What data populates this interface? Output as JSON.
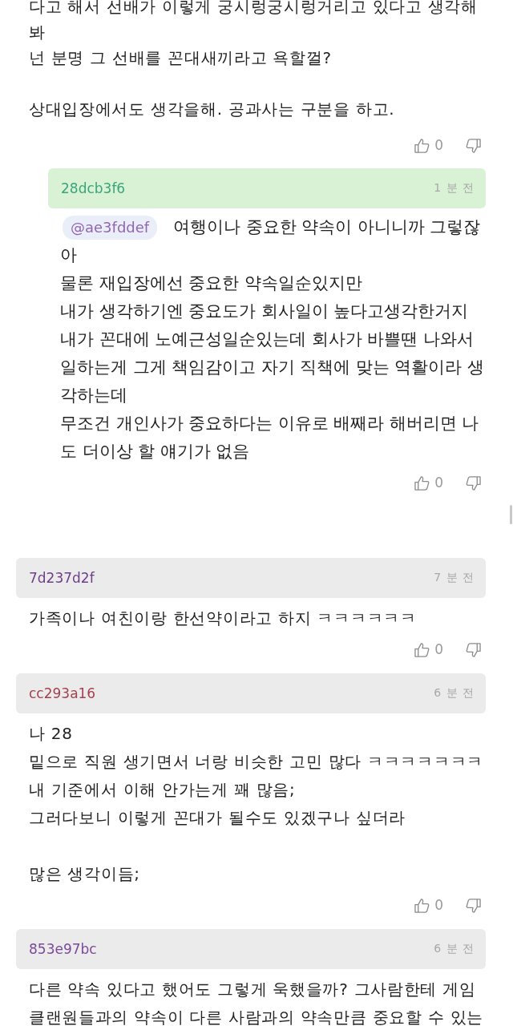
{
  "comments": [
    {
      "paragraphs": [
        [
          "다고 해서 선배가 이렇게 궁시렁궁시렁거리고 있다고 생각해봐",
          "넌 분명 그 선배를 꼰대새끼라고 욕할껄?"
        ],
        [
          "상대입장에서도 생각을해. 공과사는 구분을 하고."
        ]
      ],
      "votes": {
        "up": "0"
      },
      "replies": [
        {
          "author": "28dcb3f6",
          "color": "#3aa57a",
          "time": "1 분 전",
          "mention": "@ae3fddef",
          "paragraphs": [
            [
              "여행이나 중요한 약속이 아니니까 그렇잖아",
              "물론 재입장에선 중요한 약속일순있지만",
              "내가 생각하기엔 중요도가 회사일이 높다고생각한거지",
              "내가 꼰대에 노예근성일순있는데 회사가 바쁠땐 나와서 일하는게 그게 책임감이고 자기 직책에 맞는 역활이라 생각하는데",
              "무조건 개인사가 중요하다는 이유로 배째라 해버리면 나도 더이상 할 얘기가 없음"
            ]
          ],
          "votes": {
            "up": "0"
          }
        }
      ]
    },
    {
      "author": "7d237d2f",
      "color": "#6e3f88",
      "time": "7 분 전",
      "paragraphs": [
        [
          "가족이나 여친이랑 한선약이라고 하지 ㅋㅋㅋㅋㅋㅋ"
        ]
      ],
      "votes": {
        "up": "0"
      }
    },
    {
      "author": "cc293a16",
      "color": "#a5414f",
      "time": "6 분 전",
      "paragraphs": [
        [
          "나 28",
          "밑으로 직원 생기면서 너랑 비슷한 고민 많다 ㅋㅋㅋㅋㅋㅋㅋ",
          "내 기준에서 이해 안가는게 꽤 많음;",
          "그러다보니 이렇게 꼰대가 될수도 있겠구나 싶더라"
        ],
        [
          "많은 생각이듬;"
        ]
      ],
      "votes": {
        "up": "0"
      }
    },
    {
      "author": "853e97bc",
      "color": "#7a4b98",
      "time": "6 분 전",
      "paragraphs": [
        [
          "다른 약속 있다고 했어도 그렇게 욱했을까? 그사람한테 게임 클랜원들과의 약속이 다른 사람과의 약속만큼 중요할 수 있는"
        ]
      ]
    }
  ]
}
